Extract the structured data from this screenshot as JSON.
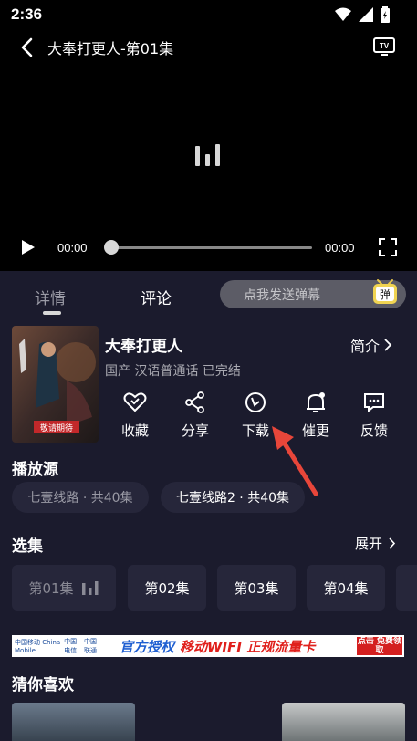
{
  "status": {
    "time": "2:36"
  },
  "player": {
    "title": "大奉打更人-第01集",
    "current_time": "00:00",
    "total_time": "00:00",
    "progress": 0
  },
  "tabs": {
    "details": "详情",
    "comments": "评论",
    "danmaku_placeholder": "点我发送弹幕",
    "danmaku_icon_text": "弹"
  },
  "show": {
    "title": "大奉打更人",
    "intro_link": "简介",
    "meta": "国产 汉语普通话 已完结",
    "poster_text": "敬请期待"
  },
  "actions": [
    {
      "label": "收藏",
      "icon": "heart-icon"
    },
    {
      "label": "分享",
      "icon": "share-icon"
    },
    {
      "label": "下载",
      "icon": "download-icon"
    },
    {
      "label": "催更",
      "icon": "bell-icon"
    },
    {
      "label": "反馈",
      "icon": "feedback-icon"
    }
  ],
  "sources": {
    "title": "播放源",
    "items": [
      {
        "label": "七壹线路 · 共40集"
      },
      {
        "label": "七壹线路2 · 共40集"
      }
    ]
  },
  "episodes": {
    "title": "选集",
    "expand_label": "展开",
    "items": [
      {
        "label": "第01集"
      },
      {
        "label": "第02集"
      },
      {
        "label": "第03集"
      },
      {
        "label": "第04集"
      }
    ]
  },
  "banner": {
    "logo_1": "中国移动 China Mobile",
    "logo_2": "中国电信",
    "logo_3": "中国联通",
    "text_1": "官方授权",
    "text_2": "移动WIFI 正规流量卡",
    "cta": "点击 免费领取"
  },
  "recommendations": {
    "title": "猜你喜欢"
  },
  "colors": {
    "background": "#1b1b2d",
    "chip": "#26263a",
    "arrow": "#e8463a",
    "banner_blue": "#1f5fd1",
    "banner_red": "#e0201c"
  }
}
